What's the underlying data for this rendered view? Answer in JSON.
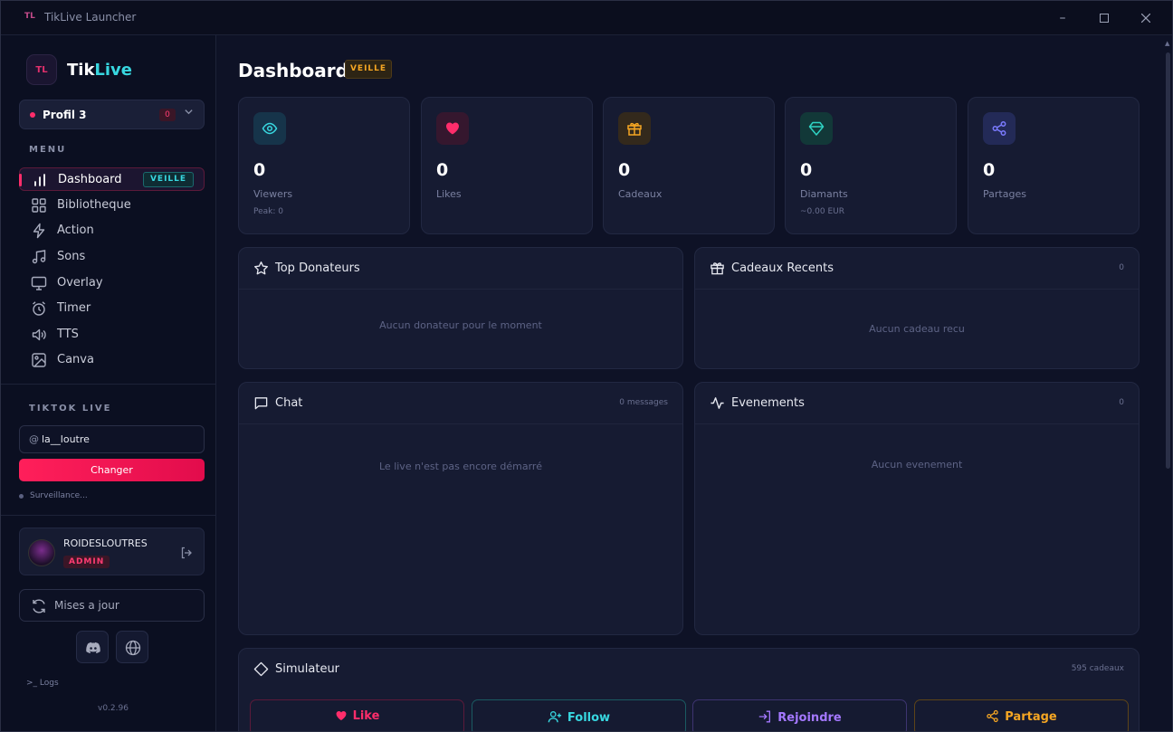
{
  "window": {
    "logo": "TL",
    "title": "TikLive Launcher"
  },
  "brand": {
    "icon": "TL",
    "name_a": "Tik",
    "name_b": "Live"
  },
  "profile": {
    "name": "Profil 3",
    "count": "0"
  },
  "menu": {
    "label": "MENU",
    "items": [
      {
        "label": "Dashboard",
        "badge": "VEILLE",
        "icon": "bar-chart-icon"
      },
      {
        "label": "Bibliotheque",
        "icon": "grid-icon"
      },
      {
        "label": "Action",
        "icon": "lightning-icon"
      },
      {
        "label": "Sons",
        "icon": "music-note-icon"
      },
      {
        "label": "Overlay",
        "icon": "monitor-icon"
      },
      {
        "label": "Timer",
        "icon": "alarm-clock-icon"
      },
      {
        "label": "TTS",
        "icon": "speaker-icon"
      },
      {
        "label": "Canva",
        "icon": "image-icon"
      }
    ]
  },
  "tiktok": {
    "label": "TIKTOK LIVE",
    "at": "@",
    "handle": "la__loutre",
    "change_label": "Changer",
    "status": "Surveillance..."
  },
  "user": {
    "name": "ROIDESLOUTRES",
    "role": "ADMIN"
  },
  "updates_label": "Mises a jour",
  "logs_label": ">_ Logs",
  "version": "v0.2.96",
  "header": {
    "title": "Dashboard",
    "badge": "VEILLE"
  },
  "stats": [
    {
      "value": "0",
      "label": "Viewers",
      "sub": "Peak: 0",
      "icon": "eye-icon",
      "color": "#38d7e0",
      "bg": "#16344a"
    },
    {
      "value": "0",
      "label": "Likes",
      "sub": "",
      "icon": "heart-icon",
      "color": "#ff2d6b",
      "bg": "#35172e"
    },
    {
      "value": "0",
      "label": "Cadeaux",
      "sub": "",
      "icon": "gift-icon",
      "color": "#f5a623",
      "bg": "#33291c"
    },
    {
      "value": "0",
      "label": "Diamants",
      "sub": "~0.00 EUR",
      "icon": "diamond-icon",
      "color": "#2fd3c3",
      "bg": "#123838"
    },
    {
      "value": "0",
      "label": "Partages",
      "sub": "",
      "icon": "share-icon",
      "color": "#7b7bff",
      "bg": "#232a57"
    }
  ],
  "panels": {
    "top_donors": {
      "title": "Top Donateurs",
      "empty": "Aucun donateur pour le moment"
    },
    "recent_gifts": {
      "title": "Cadeaux Recents",
      "meta": "0",
      "empty": "Aucun cadeau recu"
    },
    "chat": {
      "title": "Chat",
      "meta": "0 messages",
      "empty": "Le live n'est pas encore démarré"
    },
    "events": {
      "title": "Evenements",
      "meta": "0",
      "empty": "Aucun evenement"
    },
    "simulator": {
      "title": "Simulateur",
      "meta": "595 cadeaux"
    }
  },
  "simulator_buttons": [
    {
      "label": "Like",
      "color": "#ff2d6b",
      "border": "#5b1a3a"
    },
    {
      "label": "Follow",
      "color": "#38d7e0",
      "border": "#1a5a62"
    },
    {
      "label": "Rejoindre",
      "color": "#a478ff",
      "border": "#3d3470"
    },
    {
      "label": "Partage",
      "color": "#f5a623",
      "border": "#5d4418"
    }
  ]
}
